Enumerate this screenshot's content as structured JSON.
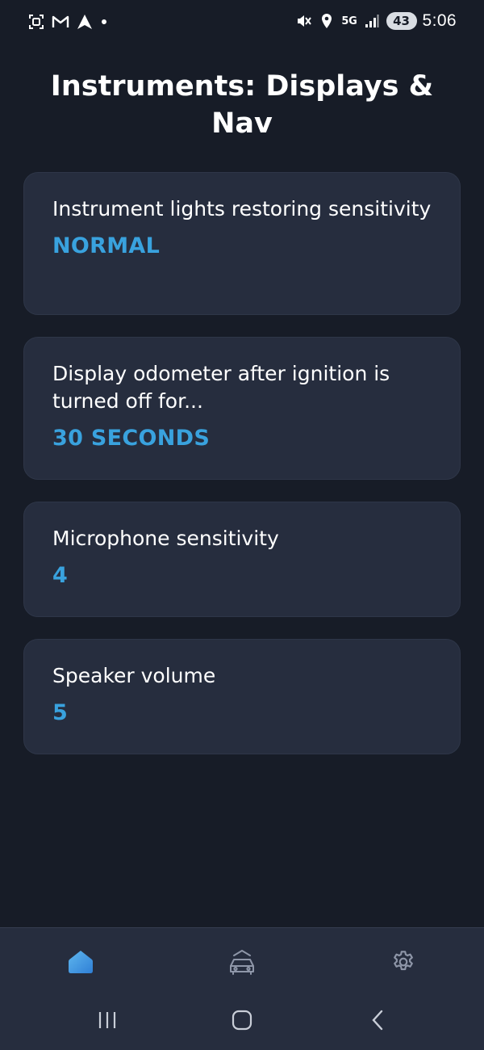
{
  "status_bar": {
    "network": "5G",
    "battery": "43",
    "time": "5:06",
    "icons": [
      "screenshot-icon",
      "gmail-icon",
      "navigation-app-icon",
      "notification-dot-icon",
      "mute-icon",
      "location-icon",
      "signal-icon"
    ]
  },
  "page": {
    "title": "Instruments: Displays & Nav"
  },
  "settings": [
    {
      "label": "Instrument lights restoring sensitivity",
      "value": "NORMAL"
    },
    {
      "label": "Display odometer after ignition is turned off for...",
      "value": "30 SECONDS"
    },
    {
      "label": "Microphone sensitivity",
      "value": "4"
    },
    {
      "label": "Speaker volume",
      "value": "5"
    }
  ],
  "bottom_nav": {
    "tabs": [
      {
        "icon": "home-icon",
        "active": true
      },
      {
        "icon": "car-icon",
        "active": false
      },
      {
        "icon": "gear-icon",
        "active": false
      }
    ]
  },
  "system_nav": [
    "recents-icon",
    "home-circle-icon",
    "back-icon"
  ],
  "colors": {
    "background": "#171c27",
    "card": "#262d3e",
    "accent": "#39a2de",
    "inactive_icon": "#8e96a8"
  }
}
